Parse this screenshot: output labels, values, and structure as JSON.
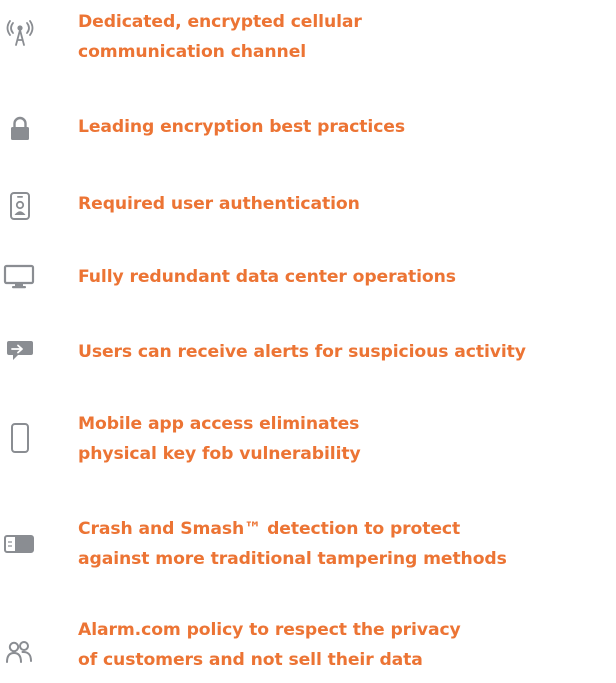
{
  "colors": {
    "text": "#ec7434",
    "icon": "#8a8d92",
    "background": "#ffffff"
  },
  "features": [
    {
      "icon": "cell-tower-icon",
      "lines": [
        "Dedicated, encrypted cellular",
        "communication channel"
      ]
    },
    {
      "icon": "lock-icon",
      "lines": [
        "Leading encryption best practices"
      ]
    },
    {
      "icon": "id-badge-icon",
      "lines": [
        "Required user authentication"
      ]
    },
    {
      "icon": "monitor-icon",
      "lines": [
        "Fully redundant data center operations"
      ]
    },
    {
      "icon": "chat-alert-icon",
      "lines": [
        "Users can receive alerts for suspicious activity"
      ]
    },
    {
      "icon": "smartphone-icon",
      "lines": [
        "Mobile app access eliminates",
        "physical key fob vulnerability"
      ]
    },
    {
      "icon": "device-sensor-icon",
      "lines": [
        "Crash and Smash™ detection to protect",
        "against more traditional tampering methods"
      ]
    },
    {
      "icon": "users-icon",
      "lines": [
        "Alarm.com policy to respect the privacy",
        "of customers and not sell their data"
      ]
    }
  ]
}
